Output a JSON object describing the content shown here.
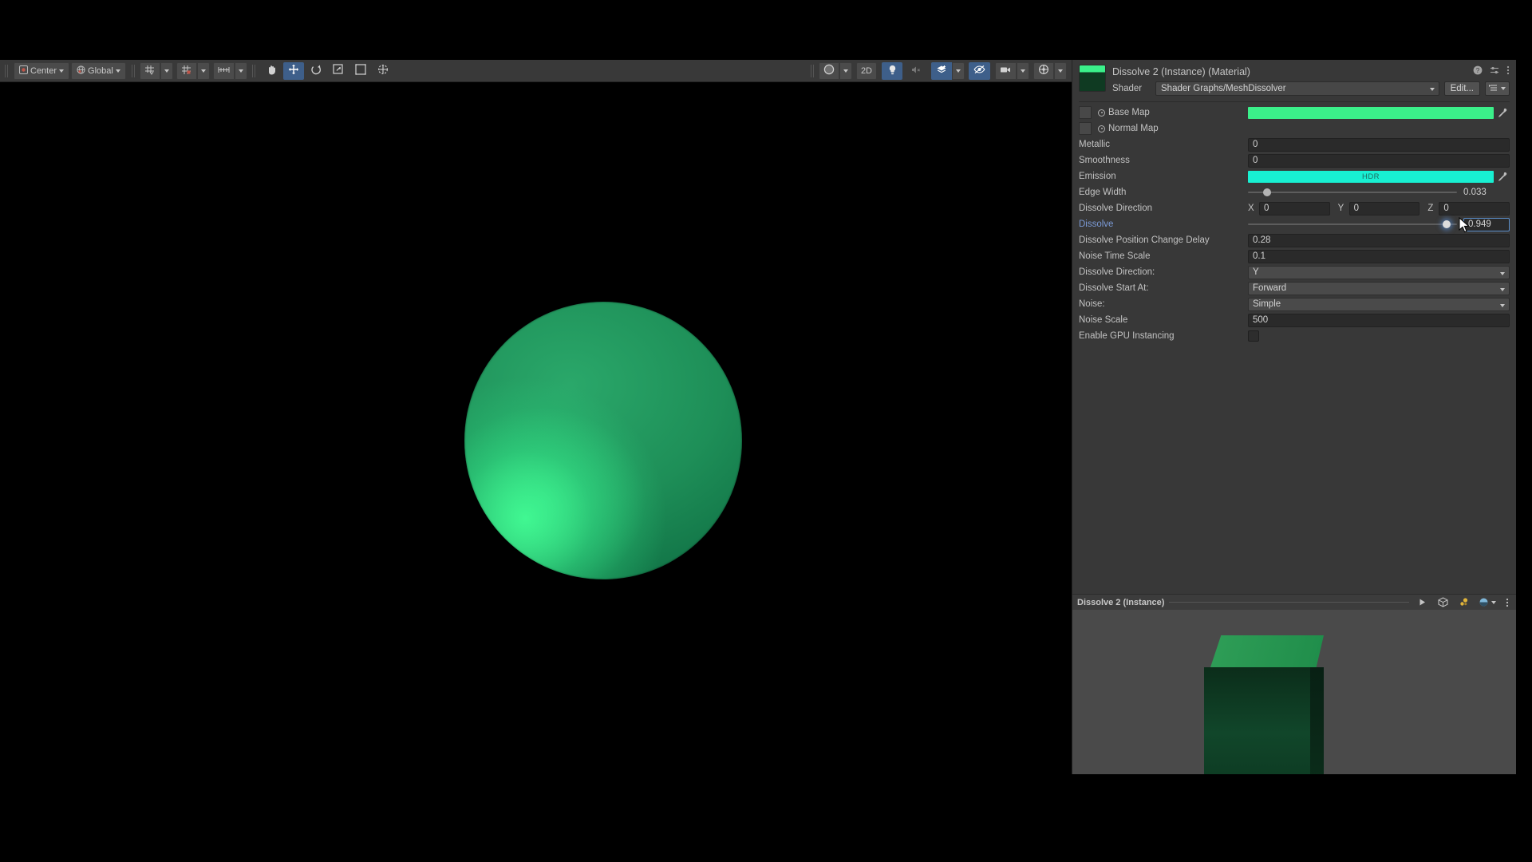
{
  "scene_toolbar": {
    "pivot_mode": {
      "label": "Center",
      "icon": "pivot-center-icon"
    },
    "handle_space": {
      "label": "Global",
      "icon": "globe-icon"
    },
    "grid_snapping": {
      "icon": "grid-snap-icon"
    },
    "grid_visibility": {
      "icon": "grid-visibility-icon"
    },
    "snap_increment": {
      "icon": "snap-increment-icon"
    },
    "tools": [
      {
        "name": "hand-tool",
        "icon": "hand-icon",
        "active": false
      },
      {
        "name": "move-tool",
        "icon": "move-arrows-icon",
        "active": true
      },
      {
        "name": "rotate-tool",
        "icon": "rotate-icon",
        "active": false
      },
      {
        "name": "scale-tool",
        "icon": "scale-icon",
        "active": false
      },
      {
        "name": "rect-tool",
        "icon": "rect-transform-icon",
        "active": false
      },
      {
        "name": "transform-tool",
        "icon": "transform-icon",
        "active": false
      }
    ],
    "draw_mode": {
      "label": "",
      "icon": "shaded-sphere-icon"
    },
    "two_d": {
      "label": "2D",
      "active": false
    },
    "lighting": {
      "icon": "lightbulb-icon",
      "active": true
    },
    "audio": {
      "icon": "audio-muted-icon",
      "active": false,
      "disabled": true
    },
    "fx": {
      "icon": "fx-layers-icon",
      "active": true
    },
    "hidden_objects": {
      "icon": "eye-off-icon",
      "active": true
    },
    "camera_settings": {
      "icon": "camera-icon",
      "active": false
    },
    "gizmos": {
      "icon": "gizmos-icon",
      "active": false
    }
  },
  "inspector": {
    "title": "Dissolve 2 (Instance) (Material)",
    "header_icons": [
      "help-icon",
      "preset-icon",
      "more-menu-icon"
    ],
    "shader": {
      "label": "Shader",
      "value": "Shader Graphs/MeshDissolver",
      "edit_label": "Edit...",
      "menu_icon": "shader-menu-icon"
    },
    "properties": [
      {
        "type": "texture",
        "label": "Base Map",
        "swatch": "#3bf08a"
      },
      {
        "type": "texture",
        "label": "Normal Map",
        "swatch": null
      },
      {
        "type": "text",
        "label": "Metallic",
        "value": "0"
      },
      {
        "type": "text",
        "label": "Smoothness",
        "value": "0"
      },
      {
        "type": "color",
        "label": "Emission",
        "swatch": "#18f0d2",
        "badge": "HDR"
      },
      {
        "type": "slider",
        "label": "Edge Width",
        "value": "0.033",
        "pct": 9
      },
      {
        "type": "vector3",
        "label": "Dissolve Direction",
        "x": "0",
        "y": "0",
        "z": "0"
      },
      {
        "type": "slider-active",
        "label": "Dissolve",
        "value": "0.949",
        "pct": 95
      },
      {
        "type": "text",
        "label": "Dissolve Position Change Delay",
        "value": "0.28"
      },
      {
        "type": "text",
        "label": "Noise Time Scale",
        "value": "0.1"
      },
      {
        "type": "enum",
        "label": "Dissolve Direction:",
        "value": "Y"
      },
      {
        "type": "enum",
        "label": "Dissolve Start At:",
        "value": "Forward"
      },
      {
        "type": "enum",
        "label": "Noise:",
        "value": "Simple"
      },
      {
        "type": "text",
        "label": "Noise Scale",
        "value": "500"
      },
      {
        "type": "checkbox",
        "label": "Enable GPU Instancing",
        "checked": false
      }
    ]
  },
  "preview": {
    "title": "Dissolve 2 (Instance)",
    "icons": [
      "play-icon",
      "mesh-cube-icon",
      "lighting-preview-icon",
      "environment-icon",
      "more-menu-icon"
    ]
  },
  "colors": {
    "accent_blue": "#3e5f8a",
    "base_map_green": "#3bf08a",
    "emission_cyan": "#18f0d2",
    "panel_bg": "#383838",
    "toolbar_bg": "#393939",
    "field_bg": "#2a2a2a",
    "preview_bg": "#4a4a4a",
    "label_blue": "#7b9ad6"
  }
}
